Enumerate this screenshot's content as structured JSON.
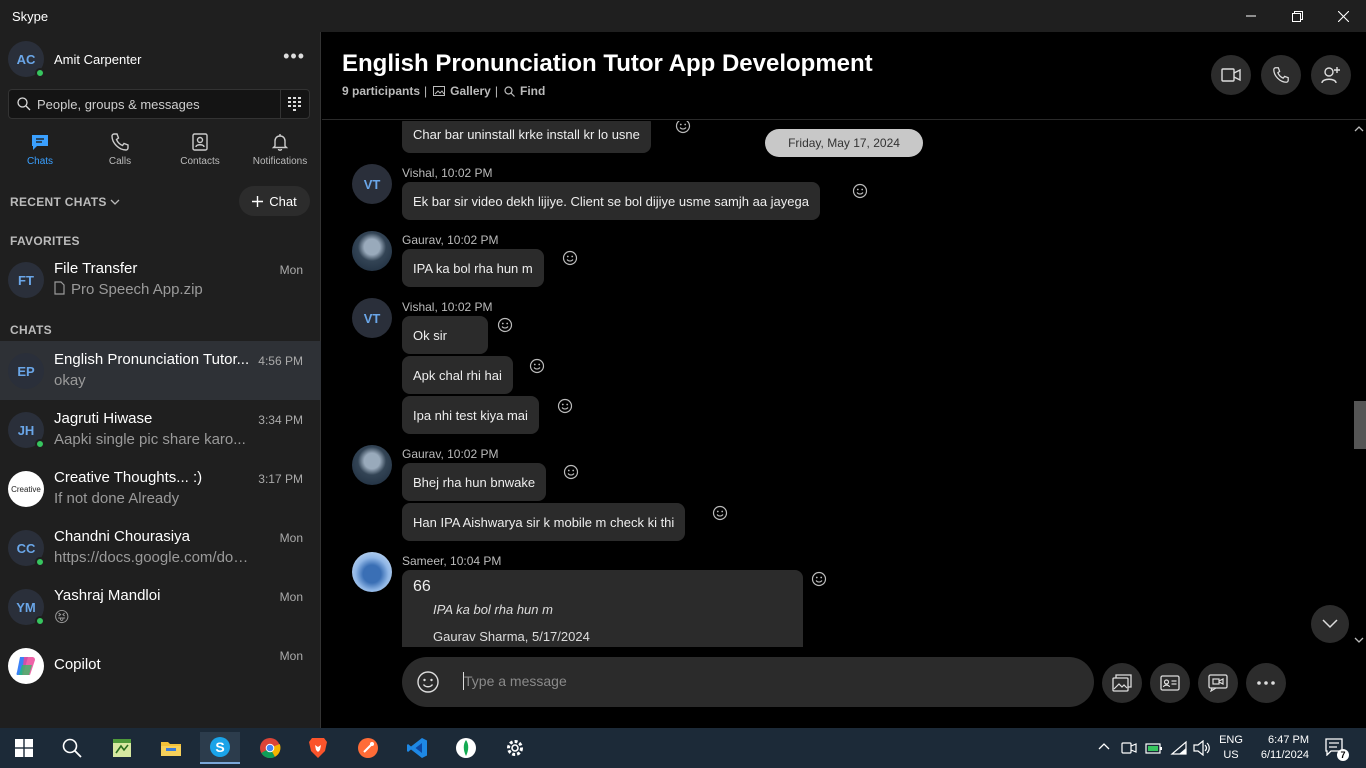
{
  "window": {
    "title": "Skype"
  },
  "profile": {
    "initials": "AC",
    "name": "Amit Carpenter"
  },
  "search": {
    "placeholder": "People, groups & messages"
  },
  "nav_tabs": [
    {
      "label": "Chats",
      "icon": "chat-icon",
      "active": true
    },
    {
      "label": "Calls",
      "icon": "phone-icon"
    },
    {
      "label": "Contacts",
      "icon": "contacts-icon"
    },
    {
      "label": "Notifications",
      "icon": "bell-icon"
    }
  ],
  "recent_chats_label": "RECENT CHATS",
  "new_chat_label": "Chat",
  "favorites": {
    "label": "FAVORITES",
    "items": [
      {
        "initials": "FT",
        "title": "File Transfer",
        "subtitle": "Pro Speech App.zip",
        "time": "Mon"
      }
    ]
  },
  "chats": {
    "label": "CHATS",
    "items": [
      {
        "initials": "EP",
        "title": "English Pronunciation Tutor...",
        "subtitle": "okay",
        "time": "4:56 PM",
        "active": true
      },
      {
        "initials": "JH",
        "title": "Jagruti Hiwase",
        "subtitle": "Aapki single pic share karo...",
        "time": "3:34 PM",
        "online": true
      },
      {
        "initials": "",
        "title": "Creative Thoughts... :)",
        "subtitle": "If not done Already",
        "time": "3:17 PM",
        "logo_text": "Creative"
      },
      {
        "initials": "CC",
        "title": "Chandni Chourasiya",
        "subtitle": "https://docs.google.com/docu...",
        "time": "Mon",
        "online": true
      },
      {
        "initials": "YM",
        "title": "Yashraj Mandloi",
        "subtitle": "😝",
        "time": "Mon",
        "online": true
      },
      {
        "initials": "",
        "title": "Copilot",
        "subtitle": "",
        "time": "Mon"
      }
    ]
  },
  "conversation": {
    "title": "English Pronunciation Tutor App Development",
    "participants": "9 participants",
    "gallery": "Gallery",
    "find": "Find",
    "date_divider": "Friday, May 17, 2024",
    "messages": [
      {
        "text": "Char bar uninstall krke install kr lo usne"
      },
      {
        "sender": "Vishal, 10:02 PM",
        "initials": "VT",
        "text": "Ek bar sir video dekh lijiye. Client se bol dijiye usme samjh aa jayega"
      },
      {
        "sender": "Gaurav, 10:02 PM",
        "text": "IPA ka bol rha hun m"
      },
      {
        "sender": "Vishal, 10:02 PM",
        "initials": "VT",
        "text": "Ok sir"
      },
      {
        "text": "Apk chal rhi hai"
      },
      {
        "text": "Ipa nhi test kiya mai"
      },
      {
        "sender": "Gaurav, 10:02 PM",
        "text": "Bhej rha hun bnwake"
      },
      {
        "text": "Han IPA Aishwarya sir k mobile m check ki thi"
      },
      {
        "sender": "Sameer, 10:04 PM",
        "quote_mark": "66",
        "quote_text": "IPA ka bol rha hun m",
        "quote_by": "Gaurav Sharma, 5/17/2024"
      }
    ],
    "composer_placeholder": "Type a message"
  },
  "taskbar": {
    "apps": [
      "windows-start-icon",
      "search-icon",
      "notepad-icon",
      "file-explorer-icon",
      "skype-icon",
      "chrome-icon",
      "brave-icon",
      "postman-icon",
      "vscode-icon",
      "mongodb-compass-icon",
      "settings-icon"
    ],
    "lang_top": "ENG",
    "lang_bottom": "US",
    "time": "6:47 PM",
    "date": "6/11/2024",
    "notification_count": "7"
  },
  "colors": {
    "accent": "#3aa0ff",
    "online": "#37c55f",
    "bubble": "#2b2b2b",
    "sidebar": "#1f1f1f",
    "taskbar": "#1c2a38"
  }
}
